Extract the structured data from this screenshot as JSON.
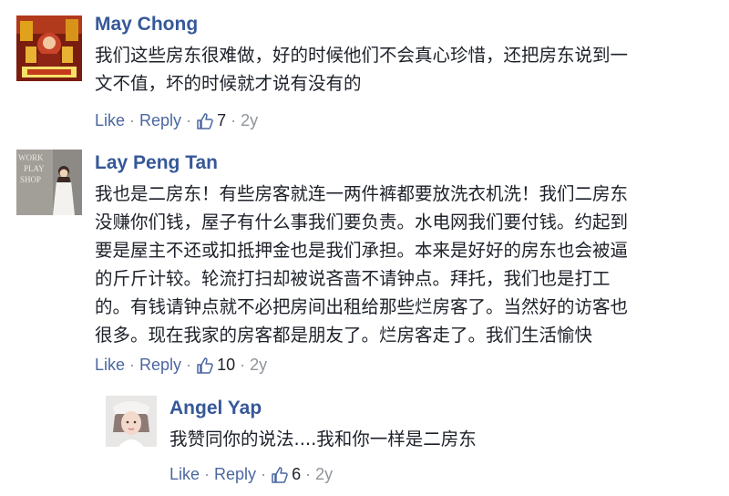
{
  "comments": [
    {
      "author": "May Chong",
      "text": "我们这些房东很难做，好的时候他们不会真心珍惜，还把房东说到一\n文不值，坏的时候就才说有没有的",
      "actions": {
        "like": "Like",
        "dot": "·",
        "reply": "Reply",
        "count": "7",
        "age": "2y"
      }
    },
    {
      "author": "Lay Peng Tan",
      "avatar_text": [
        "WORK",
        "PLAY",
        "SHOP"
      ],
      "text": "我也是二房东！有些房客就连一两件裤都要放洗衣机洗！我们二房东\n没赚你们钱，屋子有什么事我们要负责。水电网我们要付钱。约起到\n要是屋主不还或扣抵押金也是我们承担。本来是好好的房东也会被逼\n的斤斤计较。轮流打扫却被说吝啬不请钟点。拜托，我们也是打工\n的。有钱请钟点就不必把房间出租给那些烂房客了。当然好的访客也\n很多。现在我家的房客都是朋友了。烂房客走了。我们生活愉快",
      "actions": {
        "like": "Like",
        "dot": "·",
        "reply": "Reply",
        "count": "10",
        "age": "2y"
      }
    },
    {
      "author": "Angel Yap",
      "text": "我赞同你的说法....我和你一样是二房东",
      "actions": {
        "like": "Like",
        "dot": "·",
        "reply": "Reply",
        "count": "6",
        "age": "2y"
      }
    }
  ],
  "colors": {
    "name": "#365899",
    "link": "#4b67a1",
    "meta": "#90949c",
    "text": "#1d2129"
  },
  "icons": {
    "like": "thumbs-up-outline-icon"
  }
}
